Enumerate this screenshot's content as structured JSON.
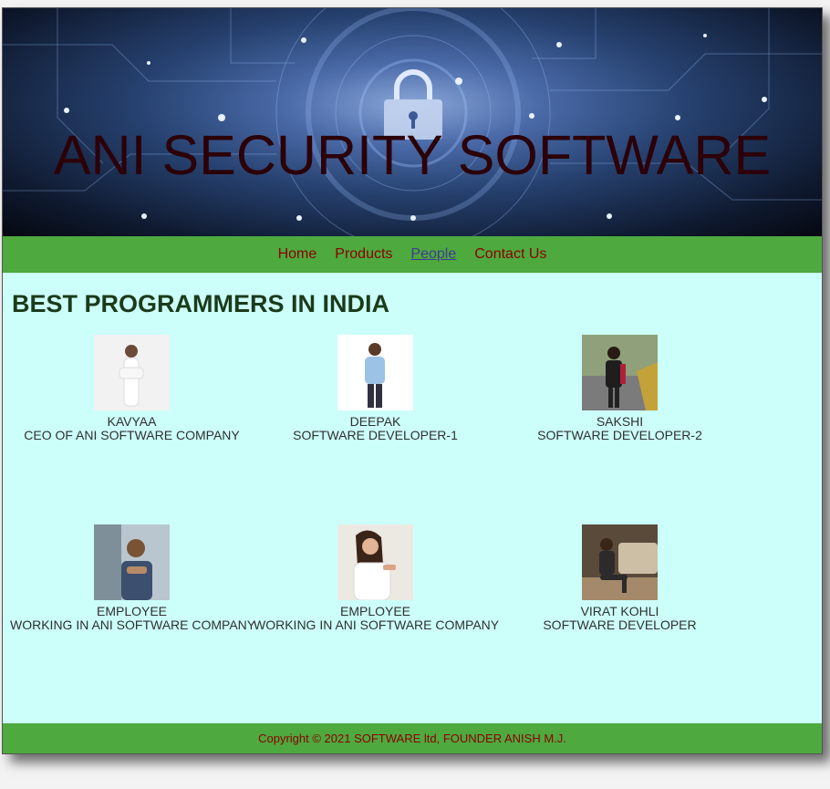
{
  "banner": {
    "title": "ANI SECURITY SOFTWARE"
  },
  "nav": {
    "items": [
      "Home",
      "Products",
      "People",
      "Contact Us"
    ],
    "active": "People"
  },
  "heading": "BEST PROGRAMMERS IN INDIA",
  "people": [
    {
      "name": "KAVYAA",
      "role": "CEO OF ANI SOFTWARE COMPANY"
    },
    {
      "name": "DEEPAK",
      "role": "SOFTWARE DEVELOPER-1"
    },
    {
      "name": "SAKSHI",
      "role": "SOFTWARE DEVELOPER-2"
    },
    {
      "name": "EMPLOYEE",
      "role": "WORKING IN ANI SOFTWARE COMPANY"
    },
    {
      "name": "EMPLOYEE",
      "role": "WORKING IN ANI SOFTWARE COMPANY"
    },
    {
      "name": "VIRAT KOHLI",
      "role": "SOFTWARE DEVELOPER"
    }
  ],
  "footer": {
    "copyright": "Copyright © 2021 SOFTWARE ltd, FOUNDER ANISH M.J."
  },
  "colors": {
    "nav_bg": "#4ea93f",
    "content_bg": "#ccfffa",
    "link": "#8b0000",
    "active_link": "#3f3b8f",
    "heading": "#1b3b1b"
  }
}
